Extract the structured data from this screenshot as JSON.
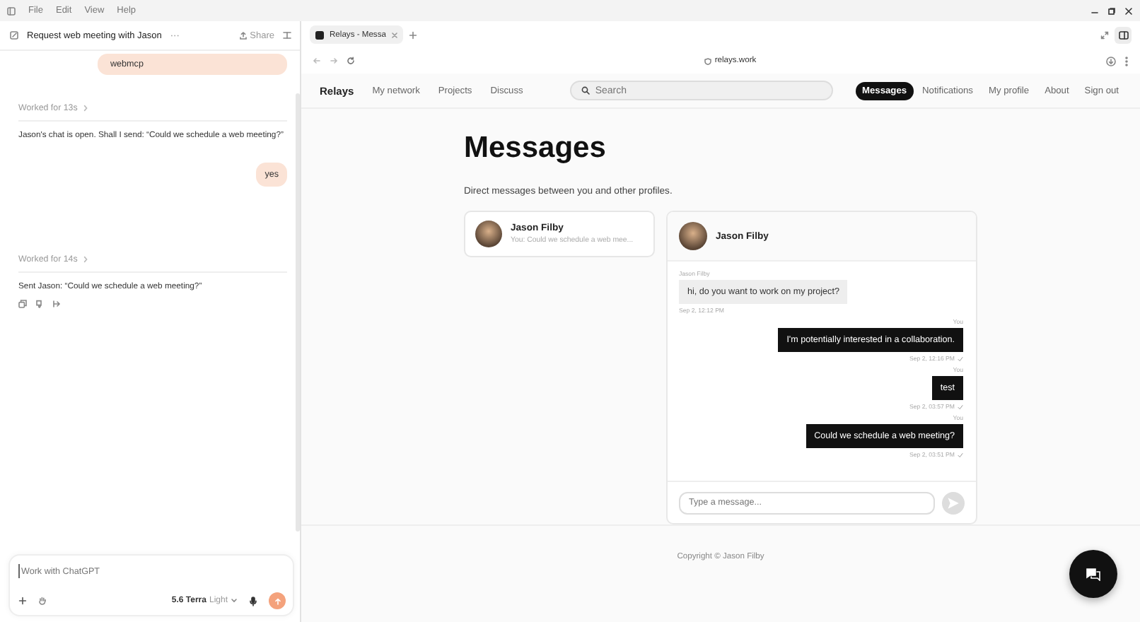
{
  "menu": [
    "File",
    "Edit",
    "View",
    "Help"
  ],
  "chat": {
    "title": "Request web meeting with Jason",
    "more": "···",
    "share": "Share",
    "messages": [
      {
        "kind": "user",
        "text": "webmcp"
      },
      {
        "kind": "status",
        "text": "Worked for 13s"
      },
      {
        "kind": "assistant",
        "text": "Jason's chat is open. Shall I send: “Could we schedule a web meeting?”"
      },
      {
        "kind": "user",
        "text": "yes"
      },
      {
        "kind": "status",
        "text": "Worked for 14s"
      },
      {
        "kind": "assistant",
        "text": "Sent Jason: “Could we schedule a web meeting?”",
        "actions": true
      }
    ],
    "composer": {
      "placeholder": "Work with ChatGPT",
      "model": "5.6 Terra",
      "effort": "Light"
    }
  },
  "browser": {
    "tab": {
      "title": "Relays - Messa",
      "selected": true
    },
    "url": "relays.work",
    "site": {
      "brand": "Relays",
      "search": {
        "placeholder": "Search"
      },
      "nav_left": [
        {
          "label": "My network",
          "selected": false
        },
        {
          "label": "Projects",
          "selected": false
        },
        {
          "label": "Discuss",
          "selected": false
        }
      ],
      "nav_right": [
        {
          "label": "Messages",
          "selected": true
        },
        {
          "label": "Notifications",
          "selected": false
        },
        {
          "label": "My profile",
          "selected": false
        },
        {
          "label": "About",
          "selected": false
        },
        {
          "label": "Sign out",
          "selected": false
        }
      ],
      "heading": "Messages",
      "subtitle": "Direct messages between you and other profiles.",
      "conversations": [
        {
          "name": "Jason Filby",
          "preview": "You: Could we schedule a web mee...",
          "selected": true
        }
      ],
      "thread": {
        "name": "Jason Filby",
        "messages": [
          {
            "sender": "Jason Filby",
            "text": "hi, do you want to work on my project?",
            "time": "Sep 2, 12:12 PM",
            "mine": false,
            "delivered": false
          },
          {
            "sender": "You",
            "text": "I'm potentially interested in a collaboration.",
            "time": "Sep 2, 12:16 PM",
            "mine": true,
            "delivered": true
          },
          {
            "sender": "You",
            "text": "test",
            "time": "Sep 2, 03:57 PM",
            "mine": true,
            "delivered": true
          },
          {
            "sender": "You",
            "text": "Could we schedule a web meeting?",
            "time": "Sep 2, 03:51 PM",
            "mine": true,
            "delivered": true
          }
        ],
        "input": {
          "placeholder": "Type a message..."
        }
      },
      "footer": "Copyright © Jason Filby"
    }
  }
}
